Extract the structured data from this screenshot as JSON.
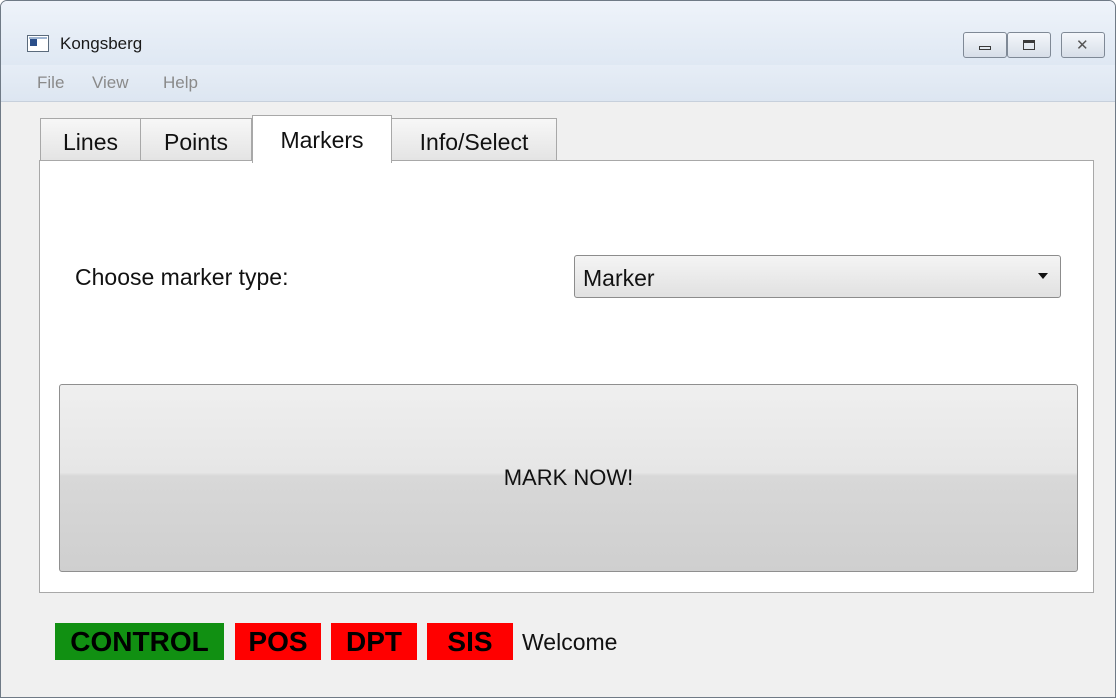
{
  "window": {
    "title": "Kongsberg",
    "controls": {
      "minimize_icon": "minimize-icon",
      "maximize_icon": "maximize-icon",
      "close_icon": "close-icon"
    }
  },
  "menu": {
    "items": [
      {
        "label": "File"
      },
      {
        "label": "View"
      },
      {
        "label": "Help"
      }
    ]
  },
  "tabs": [
    {
      "label": "Lines",
      "selected": false
    },
    {
      "label": "Points",
      "selected": false
    },
    {
      "label": "Markers",
      "selected": true
    },
    {
      "label": "Info/Select",
      "selected": false
    }
  ],
  "markers": {
    "type_label": "Choose marker type:",
    "type_value": "Marker",
    "mark_button": "MARK NOW!"
  },
  "status": {
    "indicators": [
      {
        "label": "CONTROL",
        "color": "#119012"
      },
      {
        "label": "POS",
        "color": "#ff0000"
      },
      {
        "label": "DPT",
        "color": "#ff0000"
      },
      {
        "label": "SIS",
        "color": "#ff0000"
      }
    ],
    "message": "Welcome"
  }
}
